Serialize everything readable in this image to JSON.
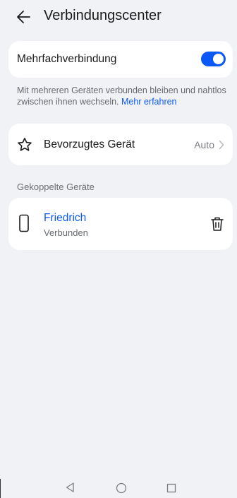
{
  "header": {
    "title": "Verbindungscenter",
    "back_icon": "arrow-left-icon"
  },
  "multi_connection": {
    "label": "Mehrfachverbindung",
    "toggle_on": true,
    "toggle_color": "#0a59f7"
  },
  "description": {
    "text": "Mit mehreren Geräten verbunden bleiben und nahtlos zwischen ihnen wechseln. ",
    "link": "Mehr erfahren"
  },
  "preferred_device": {
    "icon": "star-outline-icon",
    "label": "Bevorzugtes Gerät",
    "value": "Auto"
  },
  "paired_devices": {
    "section_title": "Gekoppelte Geräte",
    "items": [
      {
        "icon": "phone-outline-icon",
        "name": "Friedrich",
        "status": "Verbunden",
        "action_icon": "trash-icon"
      }
    ]
  },
  "system_nav": {
    "back_icon": "triangle-back-icon",
    "home_icon": "circle-home-icon",
    "recent_icon": "square-recent-icon"
  },
  "colors": {
    "accent": "#0a59f7",
    "background": "#f1f2f5",
    "card": "#ffffff"
  }
}
